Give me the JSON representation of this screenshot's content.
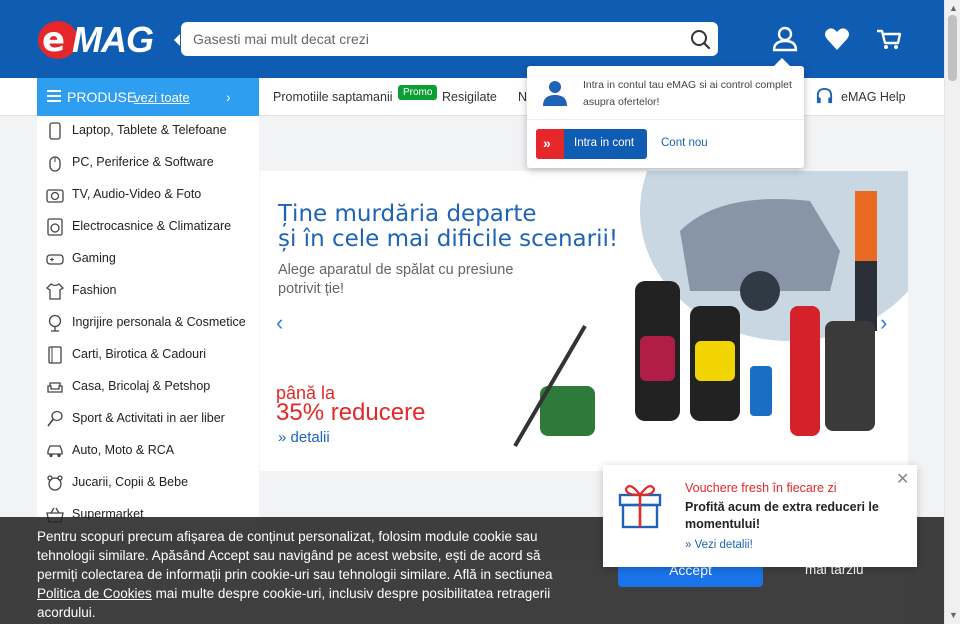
{
  "header": {
    "logo_e": "e",
    "logo_mag": "MAG",
    "search_placeholder": "Gasesti mai mult decat crezi",
    "brand_color": "#0f5cb3"
  },
  "navbar": {
    "produse_label": "PRODUSE",
    "vezi_toate": "vezi toate",
    "links": [
      "Promotiile saptamanii",
      "Resigilate",
      "N",
      "eMAG Help"
    ],
    "promo_badge": "Promo"
  },
  "sidebar": {
    "items": [
      {
        "label": "Laptop, Tablete & Telefoane",
        "icon": "phone-icon"
      },
      {
        "label": "PC, Periferice & Software",
        "icon": "mouse-icon"
      },
      {
        "label": "TV, Audio-Video & Foto",
        "icon": "camera-icon"
      },
      {
        "label": "Electrocasnice & Climatizare",
        "icon": "washer-icon"
      },
      {
        "label": "Gaming",
        "icon": "gamepad-icon"
      },
      {
        "label": "Fashion",
        "icon": "shirt-icon"
      },
      {
        "label": "Ingrijire personala & Cosmetice",
        "icon": "mirror-icon"
      },
      {
        "label": "Carti, Birotica & Cadouri",
        "icon": "book-icon"
      },
      {
        "label": "Casa, Bricolaj & Petshop",
        "icon": "sofa-icon"
      },
      {
        "label": "Sport & Activitati in aer liber",
        "icon": "racket-icon"
      },
      {
        "label": "Auto, Moto & RCA",
        "icon": "car-icon"
      },
      {
        "label": "Jucarii, Copii & Bebe",
        "icon": "bear-icon"
      },
      {
        "label": "Supermarket",
        "icon": "basket-icon"
      }
    ]
  },
  "banner": {
    "title_1": "Ține murdăria departe",
    "title_2": "și în cele mai dificile scenarii!",
    "subtitle_1": "Alege aparatul de spălat cu presiune",
    "subtitle_2": "potrivit ție!",
    "pana": "până la",
    "reducere": "35% reducere",
    "detalii": "» detalii"
  },
  "account_popup": {
    "message": "Intra in contul tau eMAG si ai control complet asupra ofertelor!",
    "login_label": "Intra in cont",
    "new_account_label": "Cont nou"
  },
  "voucher": {
    "title": "Vouchere fresh în fiecare zi",
    "description": "Profită acum de extra reduceri le momentului!",
    "link": "» Vezi detalii!"
  },
  "cookie": {
    "text_1": "Pentru scopuri precum afișarea de conținut personalizat, folosim module cookie sau tehnologii similare. Apăsând Accept sau navigând pe acest website, ești de acord să permiți colectarea de informații prin cookie-uri sau tehnologii similare. Află in sectiunea ",
    "policy_link": "Politica de Cookies",
    "text_2": " mai multe despre cookie-uri, inclusiv despre posibilitatea retragerii acordului.",
    "accept_label": "Accept",
    "later_label": "mai tarziu"
  }
}
